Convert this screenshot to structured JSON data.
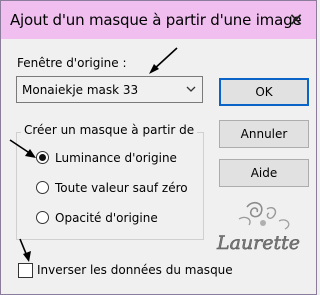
{
  "dialog": {
    "title": "Ajout d'un masque à partir d'une image",
    "close_glyph": "✕"
  },
  "source_window": {
    "label": "Fenêtre d'origine :",
    "selected": "Monaiekje mask 33"
  },
  "buttons": {
    "ok": "OK",
    "cancel": "Annuler",
    "help": "Aide"
  },
  "mask_group": {
    "legend": "Créer un masque à partir de",
    "options": [
      {
        "label": "Luminance d'origine",
        "selected": true
      },
      {
        "label": "Toute valeur sauf zéro",
        "selected": false
      },
      {
        "label": "Opacité d'origine",
        "selected": false
      }
    ]
  },
  "invert": {
    "label": "Inverser les données du masque",
    "checked": false
  },
  "watermark": {
    "text": "Laurette"
  },
  "colors": {
    "titlebar": "#f0bff0",
    "default_button_border": "#0a64c8",
    "window_bg": "#f0f0f0"
  }
}
